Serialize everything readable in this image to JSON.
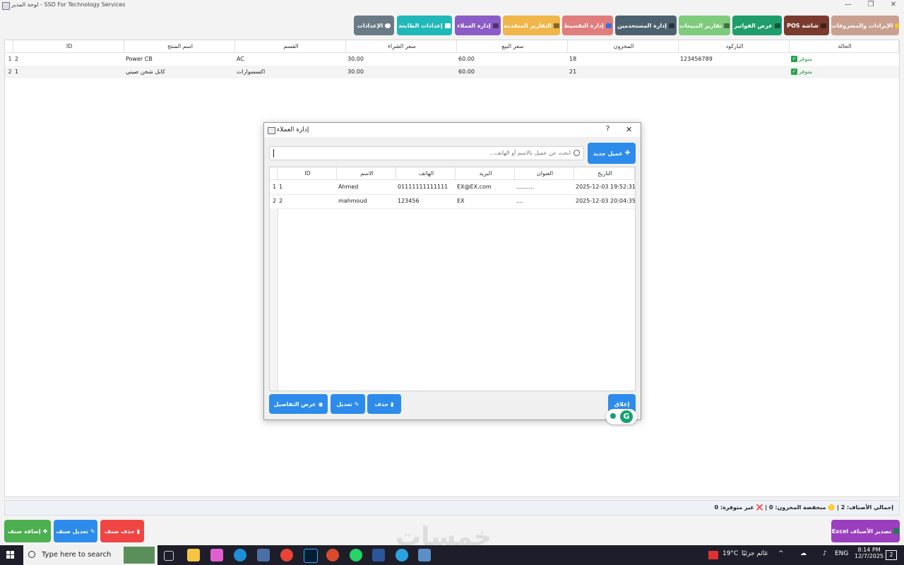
{
  "window": {
    "title": "لوحة المدير - SSD For Technology Services",
    "minimize_glyph": "—",
    "restore_glyph": "❐",
    "close_glyph": "✕"
  },
  "toolbar": {
    "buttons": [
      {
        "label": "الإيرادات والمصروفات",
        "color": "#c9a08f",
        "icon": "coins-icon"
      },
      {
        "label": "POS شاشة",
        "color": "#7a3b2e",
        "icon": "cash-register-icon"
      },
      {
        "label": "عرض الفواتير",
        "color": "#1f9d6a",
        "icon": "invoice-icon"
      },
      {
        "label": "تقارير المبيعات",
        "color": "#7ecb7e",
        "icon": "chart-icon"
      },
      {
        "label": "إدارة المستخدمين",
        "color": "#4d6270",
        "icon": "users-icon"
      },
      {
        "label": "إدارة التقسيط",
        "color": "#e07d7d",
        "icon": "installments-icon"
      },
      {
        "label": "التقارير المتقدمة",
        "color": "#f0b649",
        "icon": "reports-icon"
      },
      {
        "label": "إدارة العملاء",
        "color": "#8c5cc7",
        "icon": "customers-icon"
      },
      {
        "label": "إعدادات الطابعة",
        "color": "#20b8b8",
        "icon": "printer-icon"
      },
      {
        "label": "الإعدادات",
        "color": "#6a7b86",
        "icon": "gear-icon"
      }
    ]
  },
  "products_table": {
    "columns": [
      "ID",
      "اسم المنتج",
      "القسم",
      "سعر الشراء",
      "سعر البيع",
      "المخزون",
      "الباركود",
      "الحالة"
    ],
    "rows": [
      {
        "num": "1",
        "id": "2",
        "name": "Power CB",
        "category": "AC",
        "buy": "30.00",
        "sell": "60.00",
        "stock": "18",
        "barcode": "123456789",
        "status": "متوفر"
      },
      {
        "num": "2",
        "id": "1",
        "name": "كابل شحن صيني",
        "category": "اكسسوارات",
        "buy": "30.00",
        "sell": "60.00",
        "stock": "21",
        "barcode": "",
        "status": "متوفر"
      }
    ]
  },
  "dialog": {
    "title": "إدارة العملاء",
    "help_glyph": "?",
    "close_glyph": "✕",
    "add_button": "عميل جديد",
    "search_placeholder": "ابحث عن عميل بالاسم أو الهاتف...",
    "columns": [
      "ID",
      "الاسم",
      "الهاتف",
      "البريد",
      "العنوان",
      "التاريخ"
    ],
    "rows": [
      {
        "num": "1",
        "id": "1",
        "name": "Ahmed",
        "phone": "01111111111111",
        "email": "EX@EX.com",
        "address": "..........",
        "date": "2025-12-03 19:52:31"
      },
      {
        "num": "2",
        "id": "2",
        "name": "mahmoud",
        "phone": "123456",
        "email": "EX",
        "address": "....",
        "date": "2025-12-03 20:04:35"
      }
    ],
    "details_button": "عرض التفاصيل",
    "edit_button": "تعديل",
    "delete_button": "حذف",
    "close_button": "إغلاق"
  },
  "statusbar": {
    "text": "إجمالي الأصناف: 2 | 🟡 منخفضة المخزون: 0 | ❌ غير متوفرة: 0"
  },
  "bottom": {
    "add_item": "إضافة صنف",
    "edit_item": "تعديل صنف",
    "delete_item": "حذف صنف",
    "export_excel": "Excel تصدير الأصناف"
  },
  "watermark": "خمسات",
  "taskbar": {
    "search_placeholder": "Type here to search",
    "weather_temp": "19°C",
    "weather_desc": "غائم جزئيًا",
    "language": "ENG",
    "time": "8:14 PM",
    "date": "12/7/2025",
    "notification_count": "2"
  }
}
